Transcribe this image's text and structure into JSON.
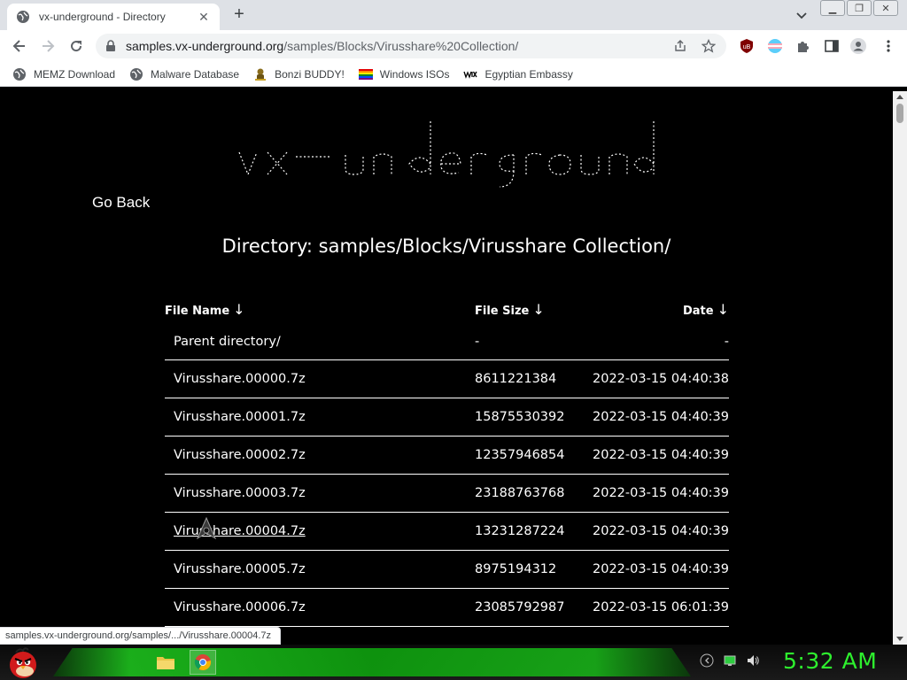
{
  "browser": {
    "tab_title": "vx-underground - Directory",
    "url_host": "samples.vx-underground.org",
    "url_path": "/samples/Blocks/Virusshare%20Collection/",
    "bookmarks": [
      {
        "label": "MEMZ Download",
        "icon": "globe-icon"
      },
      {
        "label": "Malware Database",
        "icon": "globe-icon"
      },
      {
        "label": "Bonzi BUDDY!",
        "icon": "bonzi-icon"
      },
      {
        "label": "Windows ISOs",
        "icon": "rainbow-flag-icon"
      },
      {
        "label": "Egyptian Embassy",
        "icon": "wix-icon"
      }
    ]
  },
  "page": {
    "go_back": "Go Back",
    "directory_title": "Directory: samples/Blocks/Virusshare Collection/",
    "columns": {
      "name": "File Name",
      "size": "File Size",
      "date": "Date",
      "sort_arrow": "↓"
    },
    "parent_row": {
      "name": "Parent directory/",
      "size": "-",
      "date": "-"
    },
    "rows": [
      {
        "name": "Virusshare.00000.7z",
        "size": "8611221384",
        "date": "2022-03-15 04:40:38"
      },
      {
        "name": "Virusshare.00001.7z",
        "size": "15875530392",
        "date": "2022-03-15 04:40:39"
      },
      {
        "name": "Virusshare.00002.7z",
        "size": "12357946854",
        "date": "2022-03-15 04:40:39"
      },
      {
        "name": "Virusshare.00003.7z",
        "size": "23188763768",
        "date": "2022-03-15 04:40:39"
      },
      {
        "name": "Virusshare.00004.7z",
        "size": "13231287224",
        "date": "2022-03-15 04:40:39"
      },
      {
        "name": "Virusshare.00005.7z",
        "size": "8975194312",
        "date": "2022-03-15 04:40:39"
      },
      {
        "name": "Virusshare.00006.7z",
        "size": "23085792987",
        "date": "2022-03-15 06:01:39"
      }
    ],
    "status_url": "samples.vx-underground.org/samples/.../Virusshare.00004.7z"
  },
  "taskbar": {
    "clock": "5:32 AM"
  },
  "colors": {
    "page_bg": "#000000",
    "text": "#ffffff",
    "clock": "#2ef02e",
    "taskbar_accent": "#1cbf1c"
  }
}
